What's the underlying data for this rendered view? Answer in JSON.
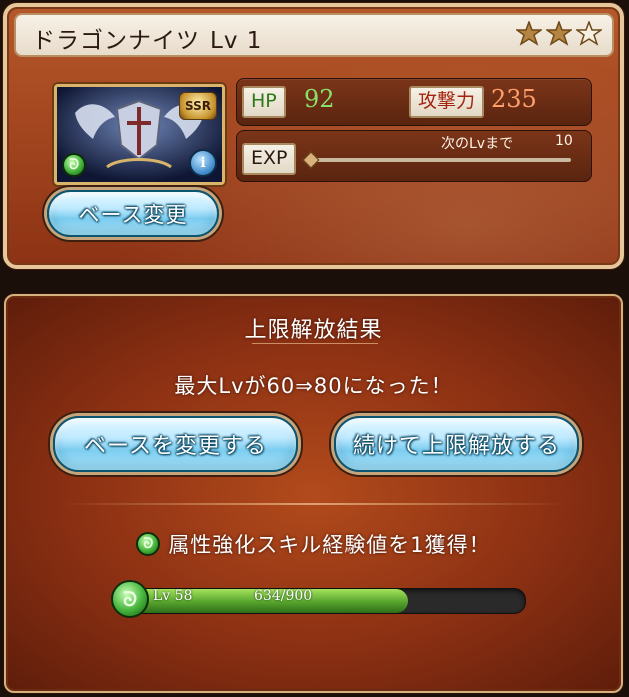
{
  "character": {
    "name": "ドラゴンナイツ",
    "level": "Lv 1",
    "stars": [
      {
        "state": "filled"
      },
      {
        "state": "filled"
      },
      {
        "state": "empty"
      }
    ],
    "rarity": "SSR",
    "element_icon": "wind-icon",
    "info_icon": "i"
  },
  "top_card": {
    "base_change_label": "ベース変更"
  },
  "stats": {
    "hp_label": "HP",
    "hp_value": "92",
    "attack_label": "攻撃力",
    "attack_value": "235",
    "exp_label": "EXP",
    "next_lv_label": "次のLvまで",
    "next_lv_value": "10",
    "exp_progress_fraction": 0.0
  },
  "result_panel": {
    "title": "上限解放結果",
    "message": "最大Lvが60⇒80になった！",
    "button_left": "ベースを変更する",
    "button_right": "続けて上限解放する",
    "skill_message": "属性強化スキル経験値を1獲得！",
    "skill_level": "Lv 58",
    "skill_progress": "634/900",
    "skill_progress_fraction": 0.7044
  },
  "colors": {
    "hp_value": "#8ae06a",
    "attack_value": "#ff9f6a",
    "progress_green": "#56a42d"
  }
}
